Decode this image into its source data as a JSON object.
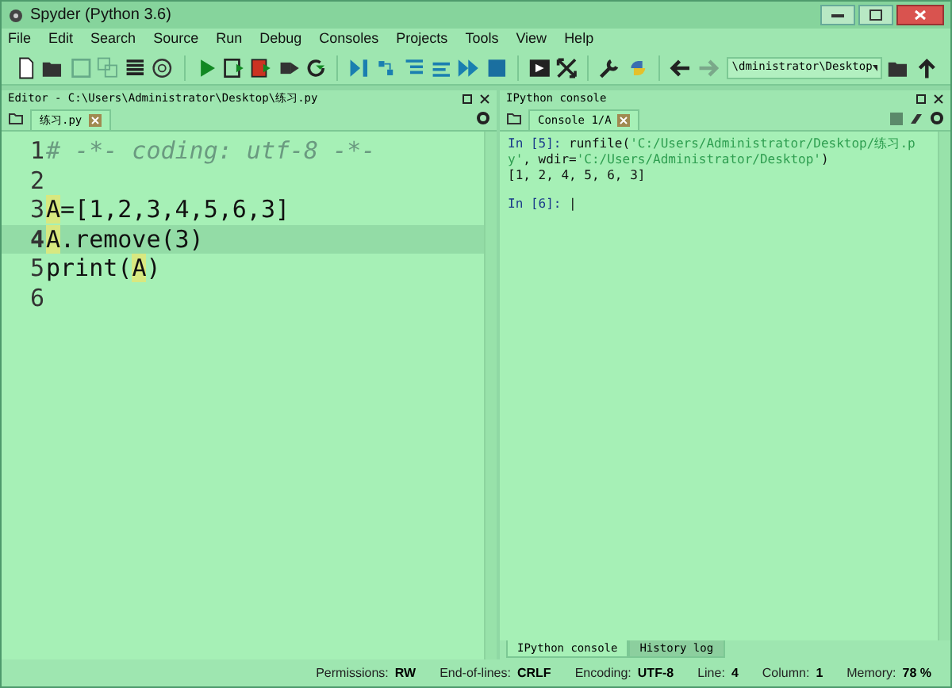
{
  "window": {
    "title": "Spyder (Python 3.6)"
  },
  "menu": [
    "File",
    "Edit",
    "Search",
    "Source",
    "Run",
    "Debug",
    "Consoles",
    "Projects",
    "Tools",
    "View",
    "Help"
  ],
  "toolbar": {
    "path": "\\dministrator\\Desktop"
  },
  "editor": {
    "title": "Editor - C:\\Users\\Administrator\\Desktop\\练习.py",
    "tabs": [
      {
        "label": "练习.py",
        "selected": true
      }
    ],
    "lines": [
      {
        "number": "1",
        "current": false,
        "kind": "comment",
        "segments": [
          {
            "text": "# -*- coding: utf-8 -*-",
            "highlighted": false
          }
        ]
      },
      {
        "number": "2",
        "current": false
      },
      {
        "number": "3",
        "current": false,
        "kind": "code",
        "segments": [
          {
            "text": "A",
            "highlighted": true
          },
          {
            "text": "=[1,2,3,4,5,6,3]",
            "highlighted": false
          }
        ]
      },
      {
        "number": "4",
        "current": true,
        "kind": "code",
        "segments": [
          {
            "text": "A",
            "highlighted": true
          },
          {
            "text": ".remove(3)",
            "highlighted": false
          }
        ]
      },
      {
        "number": "5",
        "current": false,
        "kind": "code",
        "segments": [
          {
            "text": "print(",
            "highlighted": false
          },
          {
            "text": "A",
            "highlighted": true
          },
          {
            "text": ")",
            "highlighted": false
          }
        ]
      },
      {
        "number": "6",
        "current": false
      }
    ]
  },
  "console": {
    "title": "IPython console",
    "tabs": [
      {
        "label": "Console 1/A",
        "selected": true
      }
    ],
    "blocks": [
      {
        "segments": [
          {
            "text": "In [5]: ",
            "kind": "prompt"
          },
          {
            "text": "runfile(",
            "kind": "plain"
          },
          {
            "text": "'C:/Users/Administrator/Desktop/练习.py'",
            "kind": "string"
          },
          {
            "text": ", wdir=",
            "kind": "plain"
          },
          {
            "text": "'C:/Users/Administrator/Desktop'",
            "kind": "string"
          },
          {
            "text": ")",
            "kind": "plain"
          }
        ]
      },
      {
        "segments": [
          {
            "text": "[1, 2, 4, 5, 6, 3]",
            "kind": "plain"
          }
        ]
      },
      {
        "segments": [
          {
            "text": "In [6]: ",
            "kind": "prompt"
          },
          {
            "text": "|",
            "kind": "plain"
          }
        ]
      }
    ],
    "bottom_tabs": [
      {
        "label": "IPython console",
        "selected": true
      },
      {
        "label": "History log",
        "selected": false
      }
    ]
  },
  "status_bar": [
    {
      "label": "Permissions:",
      "value": "RW"
    },
    {
      "label": "End-of-lines:",
      "value": "CRLF"
    },
    {
      "label": "Encoding:",
      "value": "UTF-8"
    },
    {
      "label": "Line:",
      "value": "4"
    },
    {
      "label": "Column:",
      "value": "1"
    },
    {
      "label": "Memory:",
      "value": "78 %"
    }
  ]
}
